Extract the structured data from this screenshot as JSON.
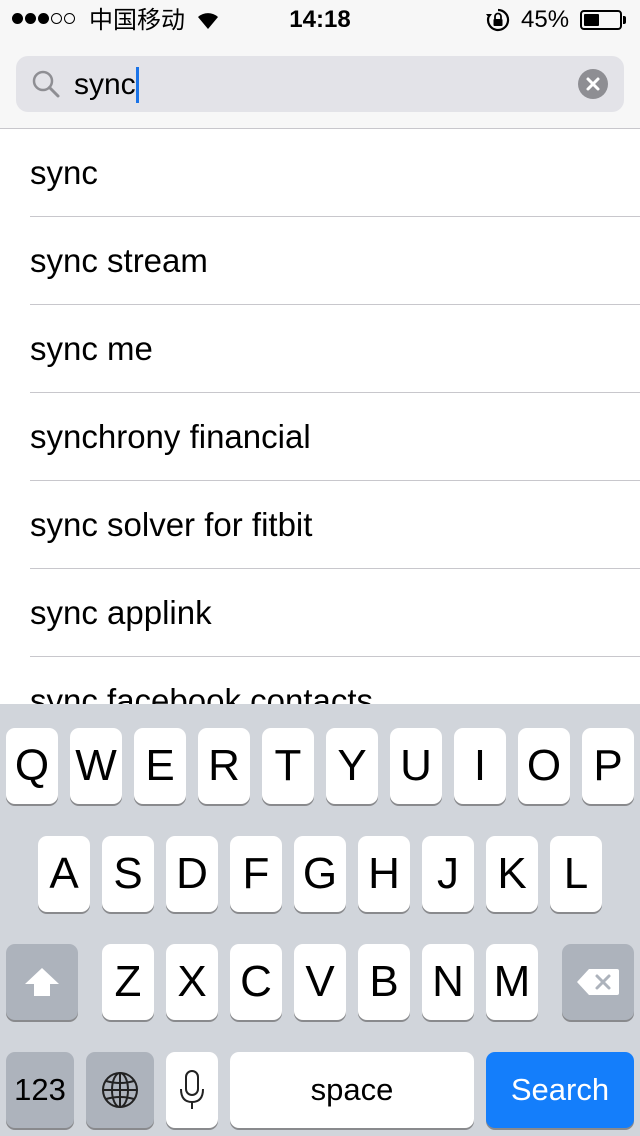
{
  "status_bar": {
    "signal_full": 3,
    "signal_empty": 2,
    "carrier": "中国移动",
    "time": "14:18",
    "battery_percent": "45%",
    "battery_level": 0.45
  },
  "search": {
    "query": "sync",
    "clear_icon": "clear-circle-icon",
    "search_icon": "magnifying-glass-icon"
  },
  "suggestions": [
    "sync",
    "sync stream",
    "sync me",
    "synchrony financial",
    "sync solver for fitbit",
    "sync applink",
    "sync facebook contacts"
  ],
  "keyboard": {
    "row1": [
      "Q",
      "W",
      "E",
      "R",
      "T",
      "Y",
      "U",
      "I",
      "O",
      "P"
    ],
    "row2": [
      "A",
      "S",
      "D",
      "F",
      "G",
      "H",
      "J",
      "K",
      "L"
    ],
    "row3": [
      "Z",
      "X",
      "C",
      "V",
      "B",
      "N",
      "M"
    ],
    "numbers_label": "123",
    "space_label": "space",
    "search_label": "Search",
    "shift_icon": "shift-arrow-icon",
    "delete_icon": "backspace-icon",
    "globe_icon": "globe-icon",
    "mic_icon": "microphone-icon"
  },
  "colors": {
    "accent": "#147efb",
    "keyboard_bg": "#d1d5db",
    "function_key": "#adb3bc"
  }
}
